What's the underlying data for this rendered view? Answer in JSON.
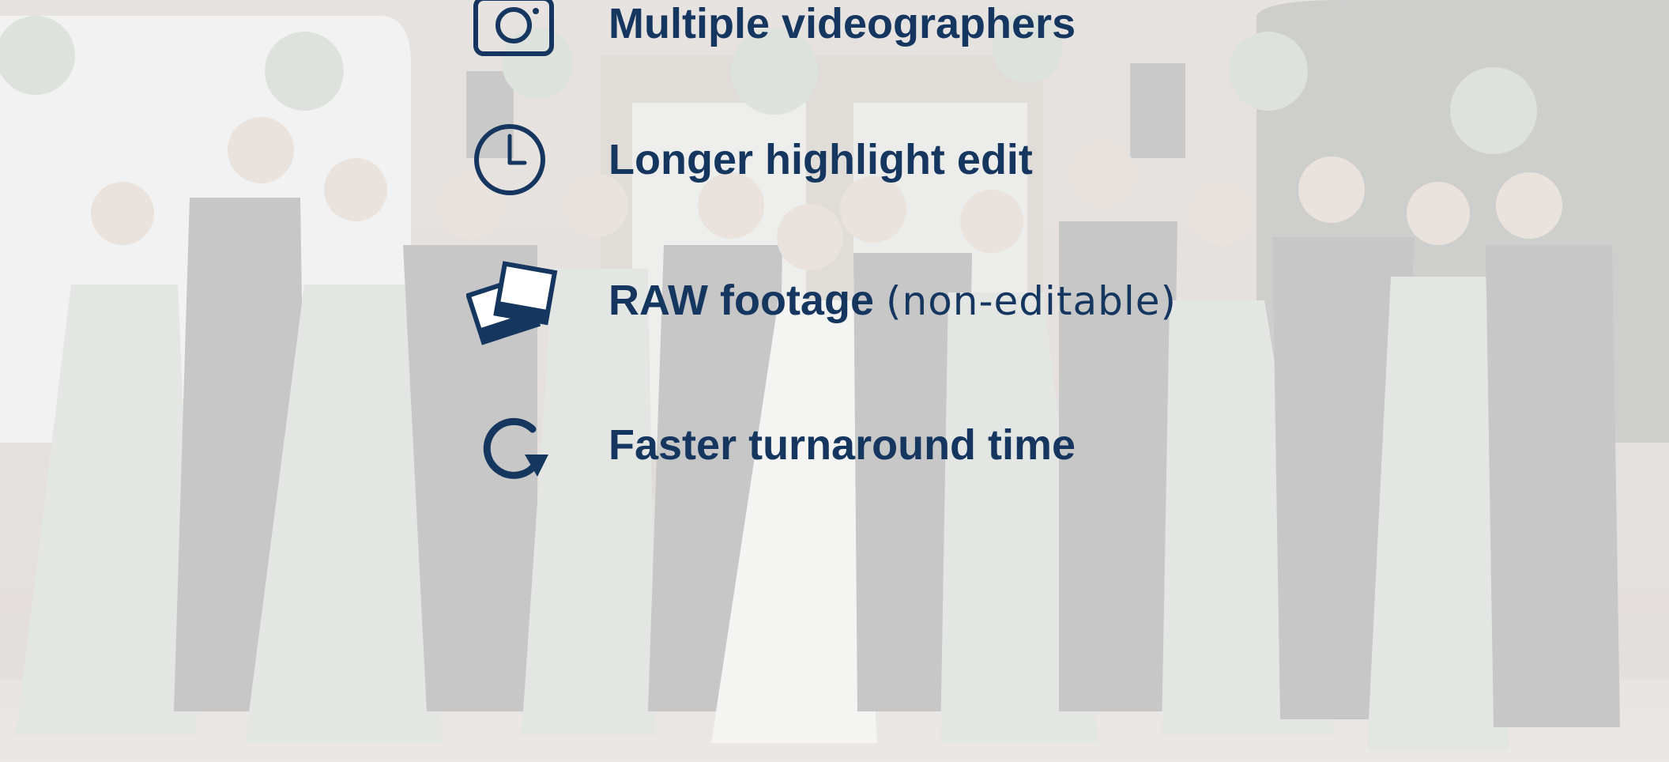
{
  "scene": {
    "description_visible": false,
    "colors": {
      "text": "#15365f",
      "icon": "#15365f",
      "wash": "#f2f2f2"
    }
  },
  "features": [
    {
      "icon": "camera-icon",
      "strong": "Multiple videographers",
      "light": ""
    },
    {
      "icon": "clock-icon",
      "strong": "Longer highlight edit",
      "light": ""
    },
    {
      "icon": "photos-icon",
      "strong": "RAW footage",
      "light": "(non-editable)"
    },
    {
      "icon": "refresh-arrow-icon",
      "strong": "Faster turnaround time",
      "light": ""
    }
  ]
}
